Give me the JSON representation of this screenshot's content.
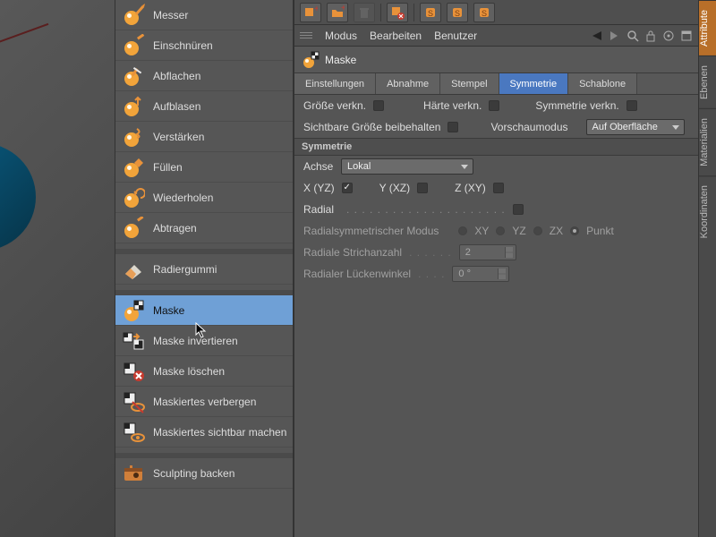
{
  "sidetabs": {
    "attribute": "Attribute",
    "ebenen": "Ebenen",
    "materialien": "Materialien",
    "koordinaten": "Koordinaten"
  },
  "tools": {
    "group1": [
      {
        "id": "messer",
        "label": "Messer"
      },
      {
        "id": "einschnueren",
        "label": "Einschnüren"
      },
      {
        "id": "abflachen",
        "label": "Abflachen"
      },
      {
        "id": "aufblasen",
        "label": "Aufblasen"
      },
      {
        "id": "verstaerken",
        "label": "Verstärken"
      },
      {
        "id": "fuellen",
        "label": "Füllen"
      },
      {
        "id": "wiederholen",
        "label": "Wiederholen"
      },
      {
        "id": "abtragen",
        "label": "Abtragen"
      }
    ],
    "group2": [
      {
        "id": "radiergummi",
        "label": "Radiergummi"
      }
    ],
    "group3": [
      {
        "id": "maske",
        "label": "Maske",
        "selected": true
      },
      {
        "id": "maske-invertieren",
        "label": "Maske invertieren"
      },
      {
        "id": "maske-loeschen",
        "label": "Maske löschen"
      },
      {
        "id": "maskiertes-verbergen",
        "label": "Maskiertes verbergen"
      },
      {
        "id": "maskiertes-sichtbar",
        "label": "Maskiertes sichtbar machen"
      }
    ],
    "group4": [
      {
        "id": "sculpting-backen",
        "label": "Sculpting backen"
      }
    ]
  },
  "menubar": {
    "modus": "Modus",
    "bearbeiten": "Bearbeiten",
    "benutzer": "Benutzer"
  },
  "object_name": "Maske",
  "tabs": {
    "einstellungen": "Einstellungen",
    "abnahme": "Abnahme",
    "stempel": "Stempel",
    "symmetrie": "Symmetrie",
    "schablone": "Schablone"
  },
  "link_row": {
    "size": "Größe verkn.",
    "hardness": "Härte verkn.",
    "sym": "Symmetrie verkn."
  },
  "keep_row": {
    "keep_size": "Sichtbare Größe beibehalten",
    "preview_mode": "Vorschaumodus",
    "preview_value": "Auf Oberfläche"
  },
  "sym": {
    "header": "Symmetrie",
    "axis_lbl": "Achse",
    "axis_val": "Lokal",
    "xyz_x": "X (YZ)",
    "xyz_y": "Y (XZ)",
    "xyz_z": "Z (XY)",
    "radial_lbl": "Radial",
    "radmode_lbl": "Radialsymmetrischer Modus",
    "radmode_xy": "XY",
    "radmode_yz": "YZ",
    "radmode_zx": "ZX",
    "radmode_punkt": "Punkt",
    "radcount_lbl": "Radiale Strichanzahl",
    "radcount_val": "2",
    "radgap_lbl": "Radialer Lückenwinkel",
    "radgap_val": "0 °"
  }
}
